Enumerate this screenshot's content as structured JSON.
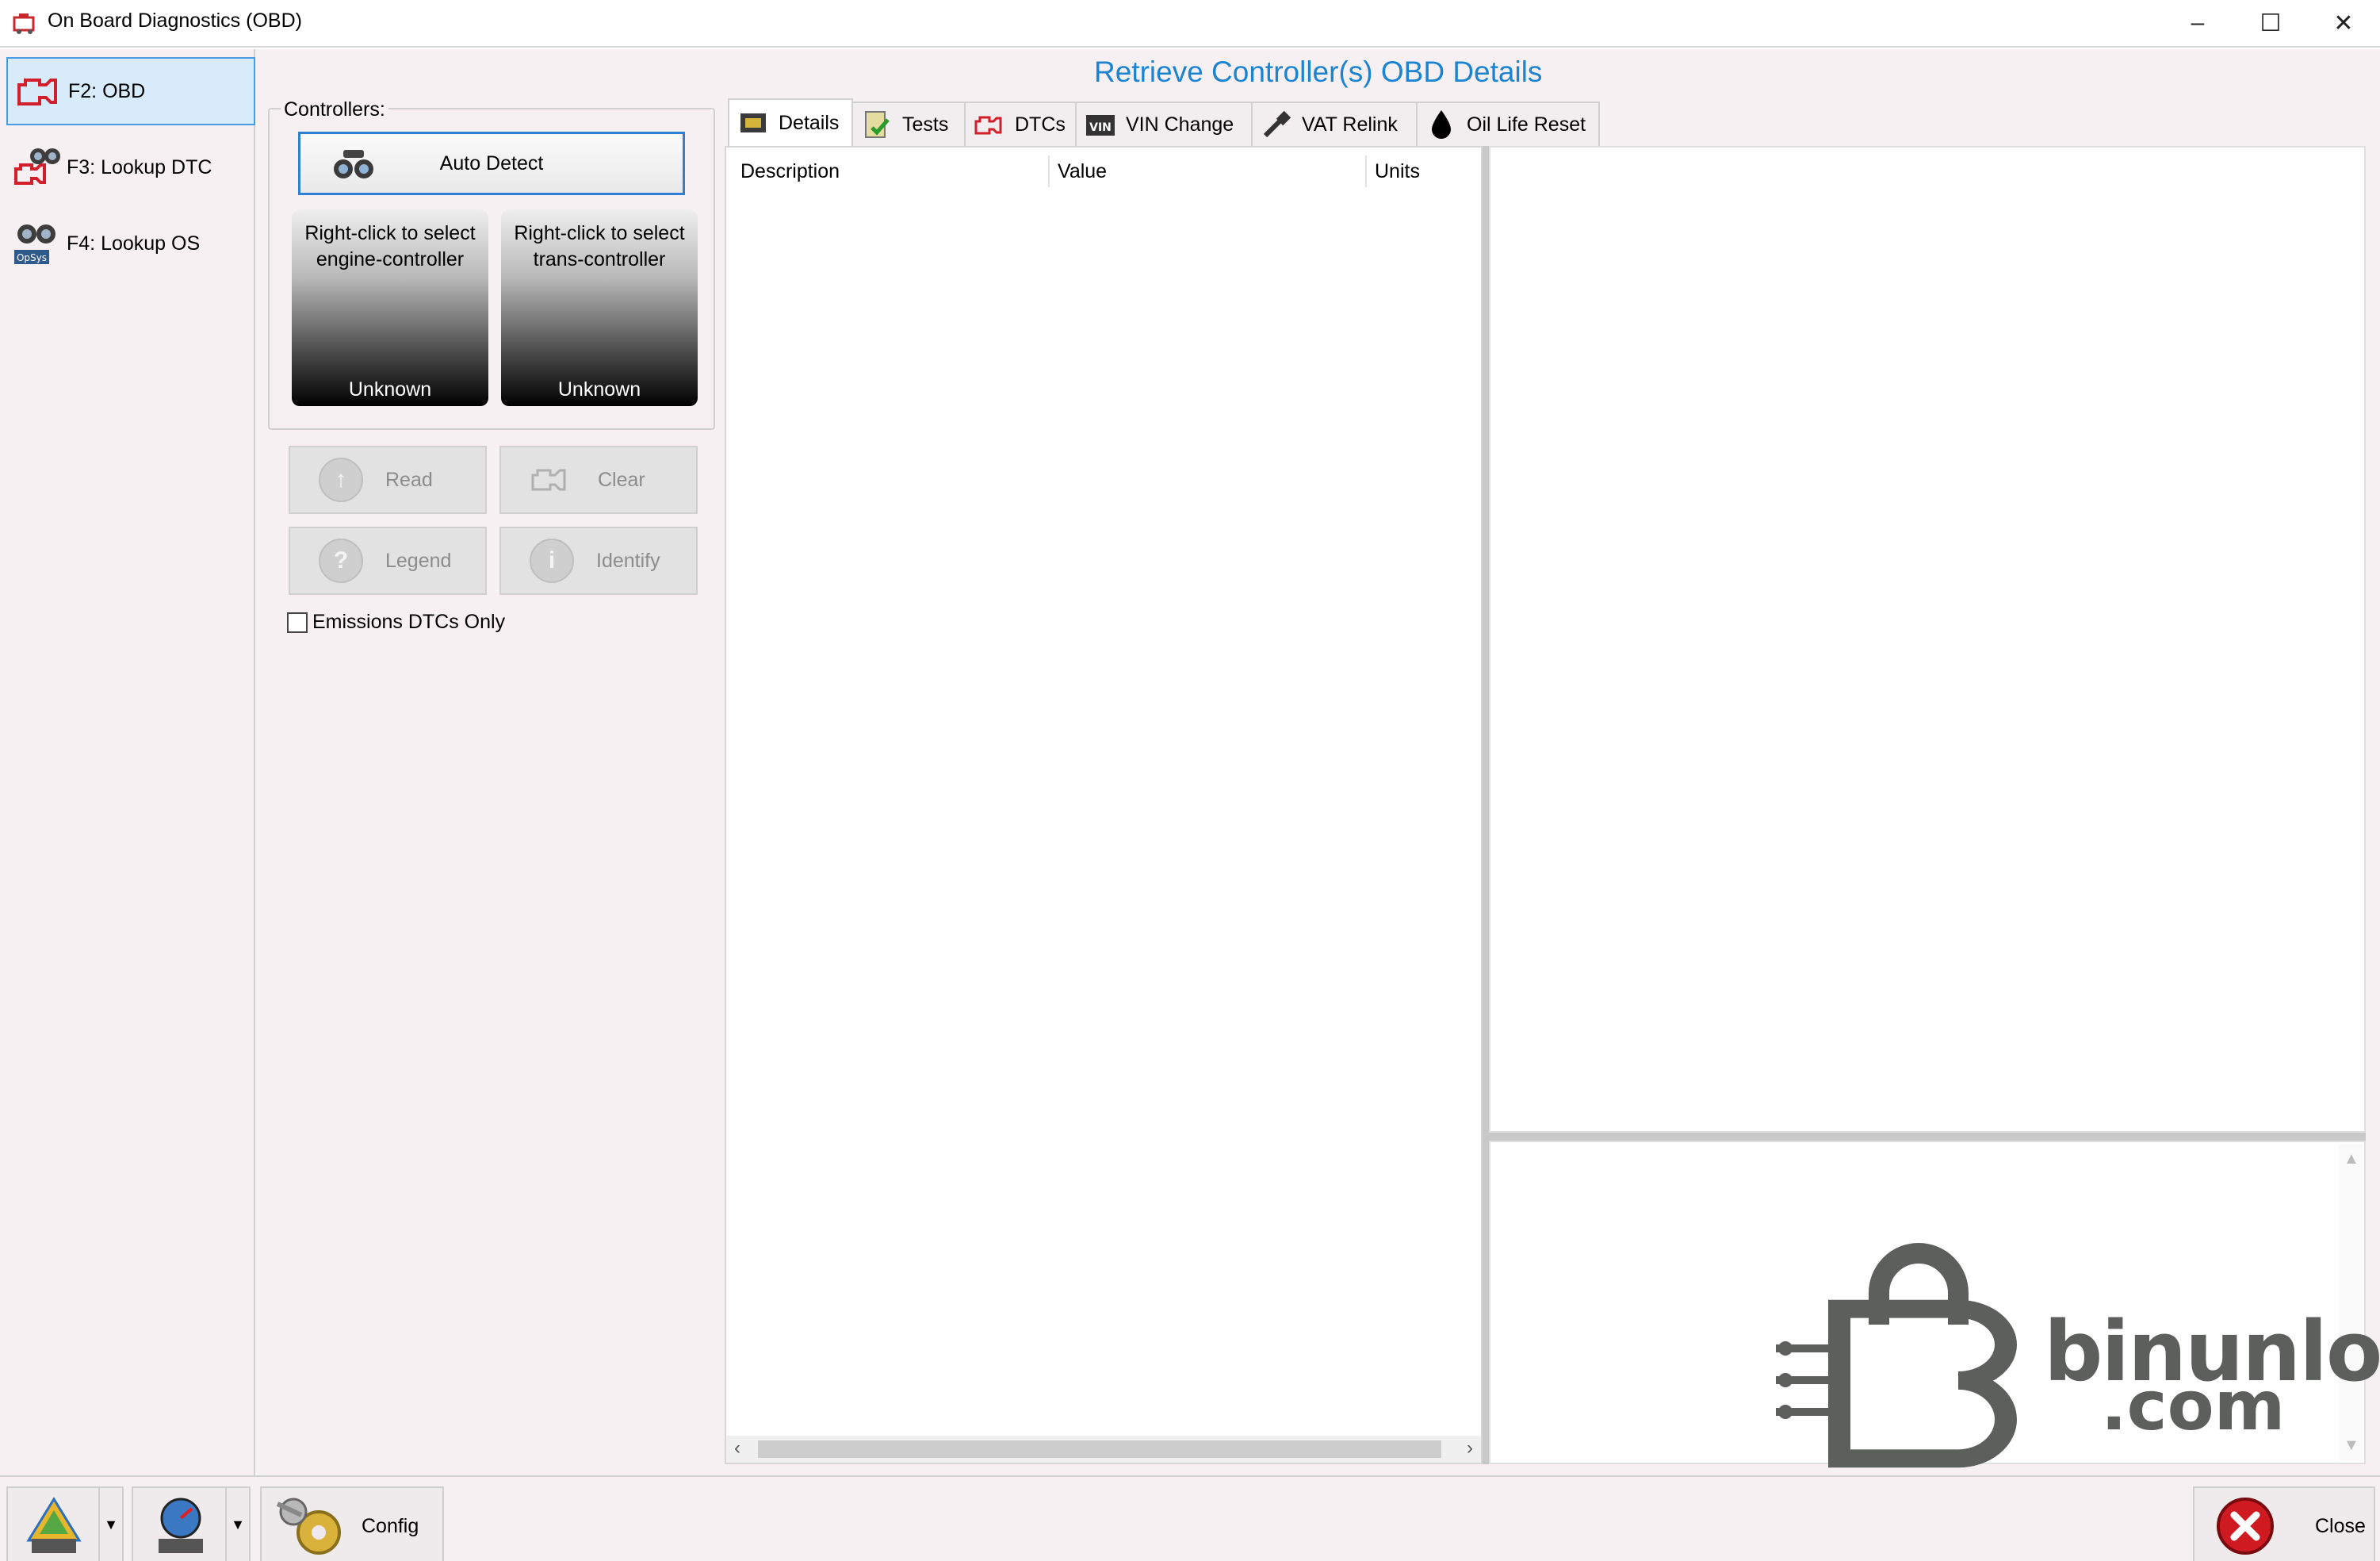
{
  "window": {
    "title": "On Board Diagnostics (OBD)",
    "minimize": "–",
    "maximize": "☐",
    "close": "✕"
  },
  "nav": {
    "items": [
      {
        "label": "F2: OBD",
        "active": true,
        "icon": "engine-check-icon"
      },
      {
        "label": "F3: Lookup DTC",
        "active": false,
        "icon": "binoculars-engine-icon"
      },
      {
        "label": "F4: Lookup OS",
        "active": false,
        "icon": "binoculars-opsys-icon"
      }
    ]
  },
  "main": {
    "title": "Retrieve Controller(s) OBD Details",
    "controllers_label": "Controllers:",
    "auto_detect": "Auto Detect",
    "engine_tile": {
      "text": "Right-click to select engine-controller",
      "status": "Unknown"
    },
    "trans_tile": {
      "text": "Right-click to select trans-controller",
      "status": "Unknown"
    },
    "buttons": {
      "read": "Read",
      "clear": "Clear",
      "legend": "Legend",
      "identify": "Identify"
    },
    "emissions_checkbox": {
      "label": "Emissions DTCs Only",
      "checked": false
    }
  },
  "tabs": [
    {
      "label": "Details",
      "active": true,
      "icon": "chip-icon"
    },
    {
      "label": "Tests",
      "active": false,
      "icon": "clipboard-check-icon"
    },
    {
      "label": "DTCs",
      "active": false,
      "icon": "engine-check-icon"
    },
    {
      "label": "VIN Change",
      "active": false,
      "icon": "vin-icon"
    },
    {
      "label": "VAT Relink",
      "active": false,
      "icon": "key-icon"
    },
    {
      "label": "Oil Life Reset",
      "active": false,
      "icon": "oil-drop-icon"
    }
  ],
  "details_table": {
    "columns": [
      "Description",
      "Value",
      "Units"
    ],
    "rows": []
  },
  "watermark": {
    "line1": "binunlock",
    "line2": ".com"
  },
  "bottom": {
    "config_label": "Config",
    "close_label": "Close"
  },
  "colors": {
    "accent": "#1b84d2",
    "nav_active": "#d7ebfa",
    "close_red": "#d01a22"
  }
}
